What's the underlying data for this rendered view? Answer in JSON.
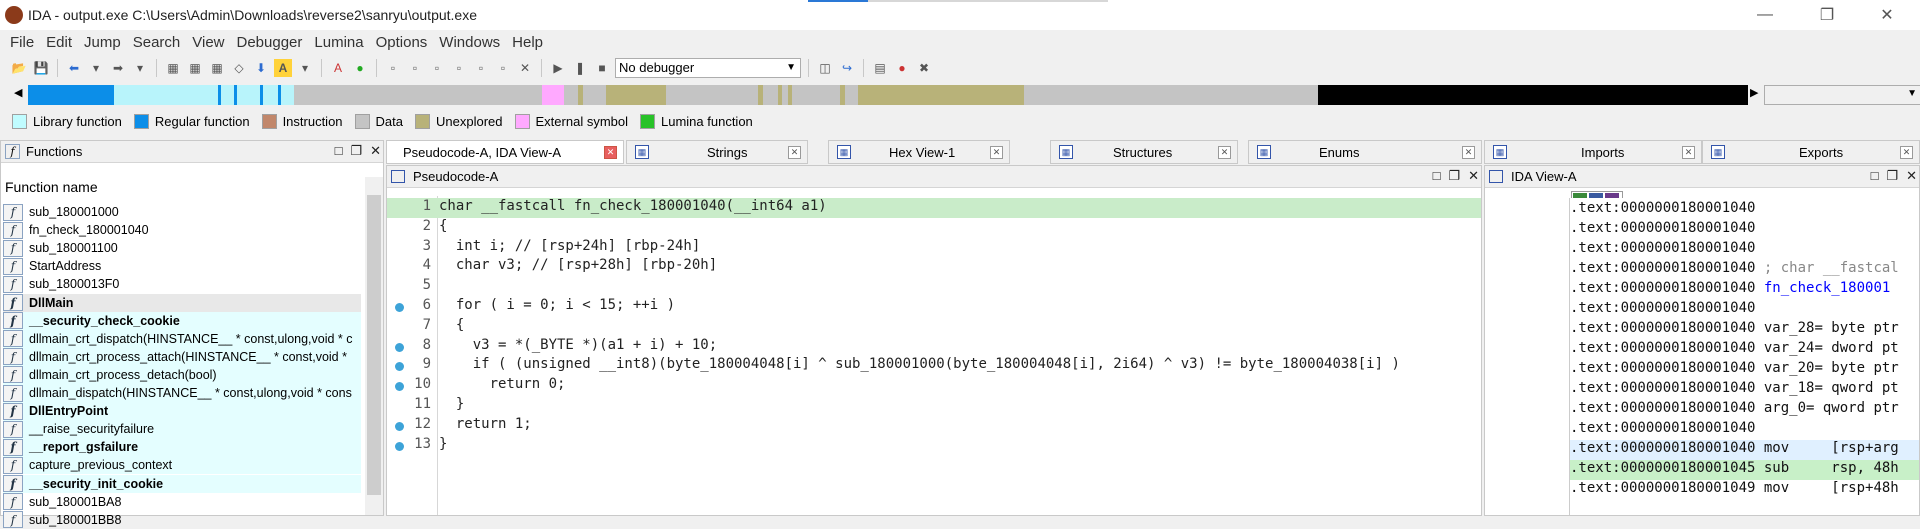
{
  "window": {
    "title": "IDA - output.exe C:\\Users\\Admin\\Downloads\\reverse2\\sanryu\\output.exe"
  },
  "menu": [
    "File",
    "Edit",
    "Jump",
    "Search",
    "View",
    "Debugger",
    "Lumina",
    "Options",
    "Windows",
    "Help"
  ],
  "toolbar": {
    "debugger_select": "No debugger"
  },
  "legend": [
    {
      "label": "Library function",
      "color": "#c0fcff"
    },
    {
      "label": "Regular function",
      "color": "#0c8ee8"
    },
    {
      "label": "Instruction",
      "color": "#c1876b"
    },
    {
      "label": "Data",
      "color": "#c4c4c4"
    },
    {
      "label": "Unexplored",
      "color": "#b8b279"
    },
    {
      "label": "External symbol",
      "color": "#ffa9ff"
    },
    {
      "label": "Lumina function",
      "color": "#28c228"
    }
  ],
  "functions": {
    "title": "Functions",
    "column_header": "Function name",
    "items": [
      {
        "name": "sub_180001000",
        "lib": false,
        "bold": false
      },
      {
        "name": "fn_check_180001040",
        "lib": false,
        "bold": false
      },
      {
        "name": "sub_180001100",
        "lib": false,
        "bold": false
      },
      {
        "name": "StartAddress",
        "lib": false,
        "bold": false
      },
      {
        "name": "sub_1800013F0",
        "lib": false,
        "bold": false
      },
      {
        "name": "DllMain",
        "lib": false,
        "bold": true,
        "selected": true
      },
      {
        "name": "__security_check_cookie",
        "lib": true,
        "bold": true
      },
      {
        "name": "dllmain_crt_dispatch(HINSTANCE__ * const,ulong,void * c",
        "lib": true,
        "bold": false
      },
      {
        "name": "dllmain_crt_process_attach(HINSTANCE__ * const,void *",
        "lib": true,
        "bold": false
      },
      {
        "name": "dllmain_crt_process_detach(bool)",
        "lib": true,
        "bold": false
      },
      {
        "name": "dllmain_dispatch(HINSTANCE__ * const,ulong,void * cons",
        "lib": true,
        "bold": false
      },
      {
        "name": "DllEntryPoint",
        "lib": true,
        "bold": true
      },
      {
        "name": "__raise_securityfailure",
        "lib": true,
        "bold": false
      },
      {
        "name": "__report_gsfailure",
        "lib": true,
        "bold": true
      },
      {
        "name": "capture_previous_context",
        "lib": true,
        "bold": false
      },
      {
        "name": "__security_init_cookie",
        "lib": true,
        "bold": true
      },
      {
        "name": "sub_180001BA8",
        "lib": false,
        "bold": false
      },
      {
        "name": "sub_180001BB8",
        "lib": false,
        "bold": false
      }
    ]
  },
  "tabs": [
    {
      "label": "Pseudocode-A, IDA View-A",
      "icon": "",
      "active": true
    },
    {
      "label": "Strings",
      "icon": "strings-icon",
      "active": false
    },
    {
      "label": "Hex View-1",
      "icon": "hex-icon",
      "active": false
    },
    {
      "label": "Structures",
      "icon": "structures-icon",
      "active": false
    },
    {
      "label": "Enums",
      "icon": "enums-icon",
      "active": false
    },
    {
      "label": "Imports",
      "icon": "imports-icon",
      "active": false
    },
    {
      "label": "Exports",
      "icon": "exports-icon",
      "active": false
    }
  ],
  "pseudocode": {
    "title": "Pseudocode-A",
    "lines": [
      {
        "n": "1",
        "dot": false,
        "hl": true,
        "text": "char __fastcall fn_check_180001040(__int64 a1)"
      },
      {
        "n": "2",
        "dot": false,
        "hl": false,
        "text": "{"
      },
      {
        "n": "3",
        "dot": false,
        "hl": false,
        "text": "  int i; // [rsp+24h] [rbp-24h]"
      },
      {
        "n": "4",
        "dot": false,
        "hl": false,
        "text": "  char v3; // [rsp+28h] [rbp-20h]"
      },
      {
        "n": "5",
        "dot": false,
        "hl": false,
        "text": ""
      },
      {
        "n": "6",
        "dot": true,
        "hl": false,
        "text": "  for ( i = 0; i < 15; ++i )"
      },
      {
        "n": "7",
        "dot": false,
        "hl": false,
        "text": "  {"
      },
      {
        "n": "8",
        "dot": true,
        "hl": false,
        "text": "    v3 = *(_BYTE *)(a1 + i) + 10;"
      },
      {
        "n": "9",
        "dot": true,
        "hl": false,
        "text": "    if ( (unsigned __int8)(byte_180004048[i] ^ sub_180001000(byte_180004048[i], 2i64) ^ v3) != byte_180004038[i] )"
      },
      {
        "n": "10",
        "dot": true,
        "hl": false,
        "text": "      return 0;"
      },
      {
        "n": "11",
        "dot": false,
        "hl": false,
        "text": "  }"
      },
      {
        "n": "12",
        "dot": true,
        "hl": false,
        "text": "  return 1;"
      },
      {
        "n": "13",
        "dot": true,
        "hl": false,
        "text": "}"
      }
    ]
  },
  "idaview": {
    "title": "IDA View-A",
    "rows": [
      {
        "addr": ".text:0000000180001040",
        "op": "",
        "arg": "",
        "cls": ""
      },
      {
        "addr": ".text:0000000180001040",
        "op": "",
        "arg": "",
        "cls": ""
      },
      {
        "addr": ".text:0000000180001040",
        "op": "",
        "arg": "",
        "cls": ""
      },
      {
        "addr": ".text:0000000180001040",
        "op": "; char __fastcal",
        "arg": "",
        "cls": "cmt"
      },
      {
        "addr": ".text:0000000180001040",
        "op": "fn_check_180001",
        "arg": "",
        "cls": "blue"
      },
      {
        "addr": ".text:0000000180001040",
        "op": "",
        "arg": "",
        "cls": ""
      },
      {
        "addr": ".text:0000000180001040",
        "op": "var_28= byte ptr",
        "arg": "",
        "cls": ""
      },
      {
        "addr": ".text:0000000180001040",
        "op": "var_24= dword pt",
        "arg": "",
        "cls": ""
      },
      {
        "addr": ".text:0000000180001040",
        "op": "var_20= byte ptr",
        "arg": "",
        "cls": ""
      },
      {
        "addr": ".text:0000000180001040",
        "op": "var_18= qword pt",
        "arg": "",
        "cls": ""
      },
      {
        "addr": ".text:0000000180001040",
        "op": "arg_0= qword ptr",
        "arg": "",
        "cls": ""
      },
      {
        "addr": ".text:0000000180001040",
        "op": "",
        "arg": "",
        "cls": ""
      },
      {
        "addr": ".text:0000000180001040",
        "op": "mov     [rsp+arg",
        "arg": "",
        "cls": "hi"
      },
      {
        "addr": ".text:0000000180001045",
        "op": "sub     rsp, 48h",
        "arg": "",
        "cls": "gn"
      },
      {
        "addr": ".text:0000000180001049",
        "op": "mov     [rsp+48h",
        "arg": "",
        "cls": ""
      }
    ]
  }
}
